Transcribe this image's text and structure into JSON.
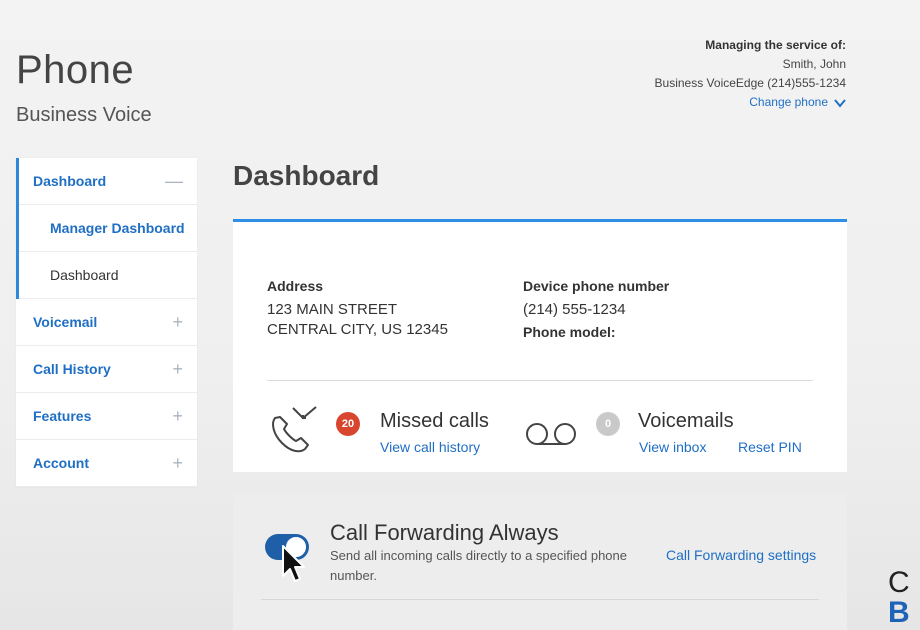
{
  "header": {
    "title": "Phone",
    "subtitle": "Business Voice"
  },
  "service": {
    "heading": "Managing the service of:",
    "name": "Smith, John",
    "line": "Business VoiceEdge (214)555-1234",
    "change_label": "Change phone"
  },
  "sidebar": {
    "dashboard_label": "Dashboard",
    "dashboard_sign": "—",
    "sub_items": [
      "Manager Dashboard",
      "Dashboard"
    ],
    "items": [
      {
        "label": "Voicemail",
        "sign": "+"
      },
      {
        "label": "Call History",
        "sign": "+"
      },
      {
        "label": "Features",
        "sign": "+"
      },
      {
        "label": "Account",
        "sign": "+"
      }
    ]
  },
  "main": {
    "title": "Dashboard",
    "address_label": "Address",
    "address_line1": "123 MAIN STREET",
    "address_line2": "CENTRAL CITY, US 12345",
    "device_label": "Device phone number",
    "device_number": "(214) 555-1234",
    "model_label": "Phone model:",
    "missed_count": "20",
    "missed_title": "Missed calls",
    "missed_link": "View call history",
    "voicemail_count": "0",
    "voicemail_title": "Voicemails",
    "voicemail_link": "View inbox",
    "reset_link": "Reset PIN"
  },
  "forwarding": {
    "title": "Call Forwarding Always",
    "description": "Send all incoming calls directly to a specified phone number.",
    "settings_link": "Call Forwarding settings",
    "enabled": true
  },
  "corner_logo": {
    "line1": "C",
    "line2": "B"
  },
  "colors": {
    "link": "#1f6fc4",
    "accent": "#2f8fe6",
    "badge_red": "#d9462f",
    "toggle": "#1f5fa8"
  }
}
